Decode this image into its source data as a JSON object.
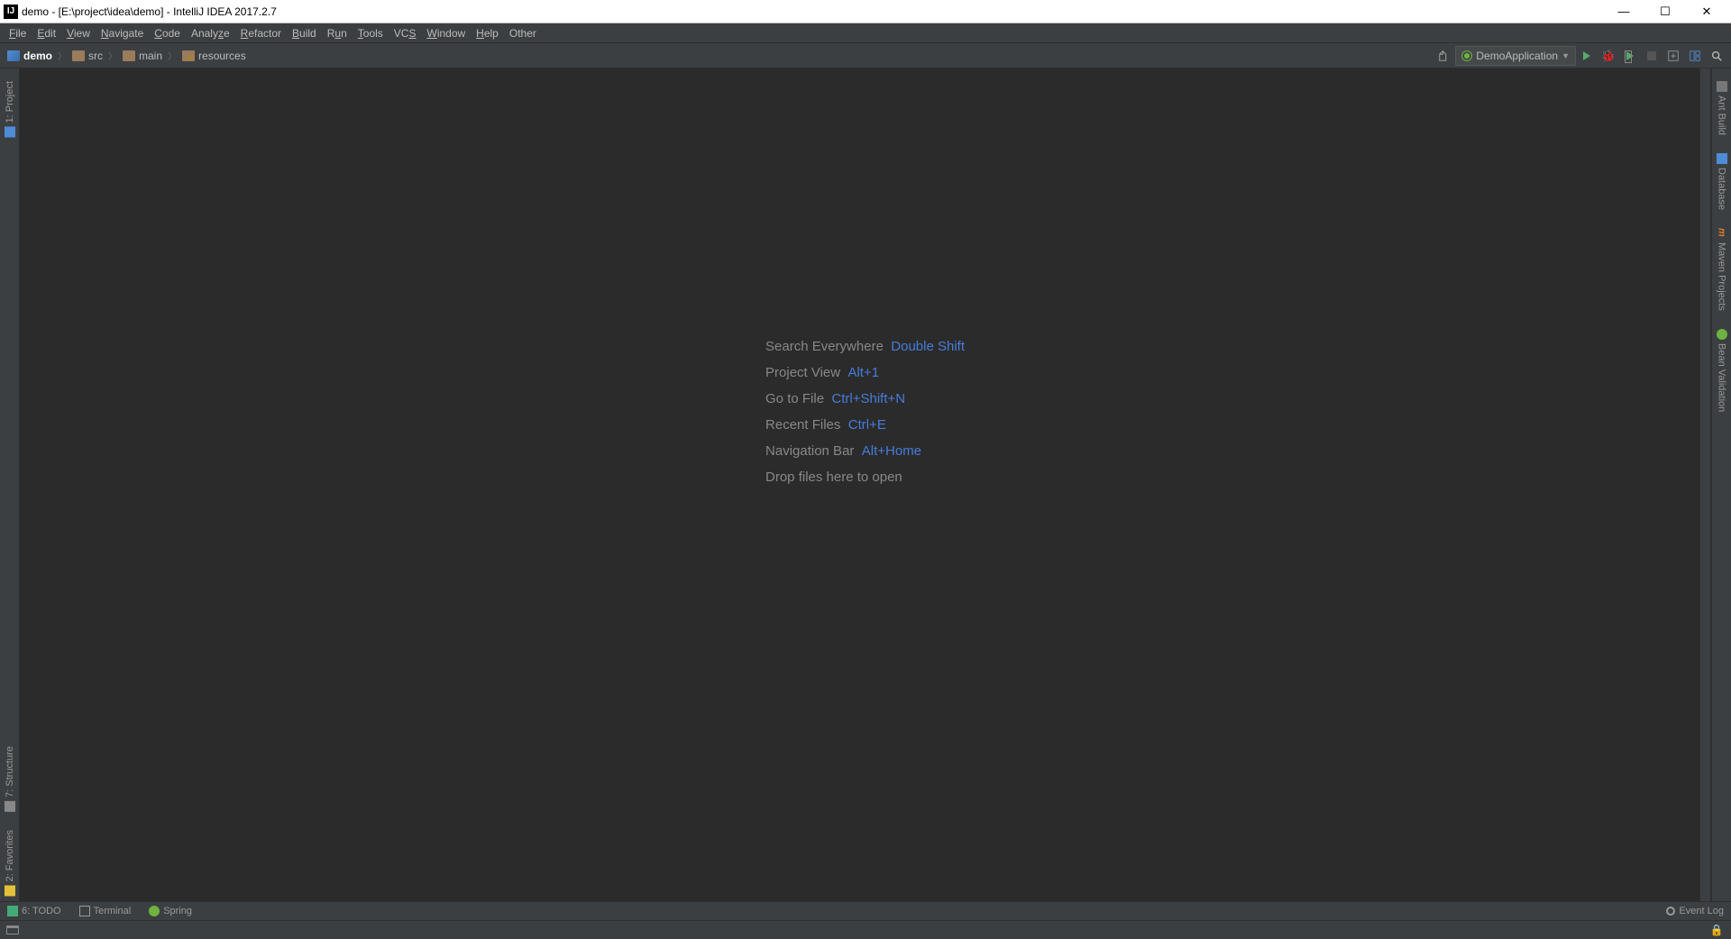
{
  "titlebar": {
    "title": "demo - [E:\\project\\idea\\demo] - IntelliJ IDEA 2017.2.7"
  },
  "menu": [
    "File",
    "Edit",
    "View",
    "Navigate",
    "Code",
    "Analyze",
    "Refactor",
    "Build",
    "Run",
    "Tools",
    "VCS",
    "Window",
    "Help",
    "Other"
  ],
  "breadcrumb": [
    "demo",
    "src",
    "main",
    "resources"
  ],
  "run_config": {
    "label": "DemoApplication"
  },
  "left_tabs": {
    "project": "1: Project",
    "structure": "7: Structure",
    "favorites": "2: Favorites"
  },
  "right_tabs": {
    "ant": "Ant Build",
    "database": "Database",
    "maven": "Maven Projects",
    "bean": "Bean Validation"
  },
  "hints": [
    {
      "label": "Search Everywhere",
      "key": "Double Shift"
    },
    {
      "label": "Project View",
      "key": "Alt+1"
    },
    {
      "label": "Go to File",
      "key": "Ctrl+Shift+N"
    },
    {
      "label": "Recent Files",
      "key": "Ctrl+E"
    },
    {
      "label": "Navigation Bar",
      "key": "Alt+Home"
    }
  ],
  "drop_hint": "Drop files here to open",
  "bottom_tabs": {
    "todo": "6: TODO",
    "terminal": "Terminal",
    "spring": "Spring",
    "event_log": "Event Log"
  }
}
